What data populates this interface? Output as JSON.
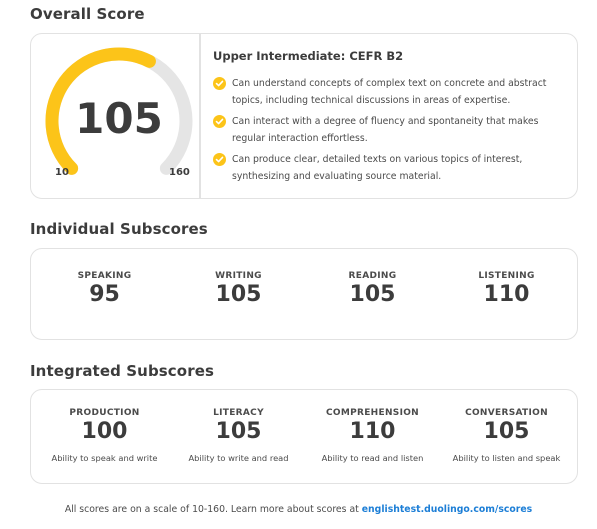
{
  "overall": {
    "title": "Overall Score",
    "score": "105",
    "min_label": "10",
    "max_label": "160",
    "progress_fraction": 0.6,
    "gauge_color": "#fcc419",
    "gauge_track_color": "#e5e5e5",
    "level_title": "Upper Intermediate: CEFR B2",
    "descriptors": [
      "Can understand concepts of complex text on concrete and abstract topics, including technical discussions in areas of expertise.",
      "Can interact with a degree of fluency and spontaneity that makes regular interaction effortless.",
      "Can produce clear, detailed texts on various topics of interest, synthesizing and evaluating source material."
    ],
    "descriptor_icon": "check-circle-icon"
  },
  "individual": {
    "title": "Individual Subscores",
    "items": [
      {
        "label": "SPEAKING",
        "value": "95"
      },
      {
        "label": "WRITING",
        "value": "105"
      },
      {
        "label": "READING",
        "value": "105"
      },
      {
        "label": "LISTENING",
        "value": "110"
      }
    ]
  },
  "integrated": {
    "title": "Integrated Subscores",
    "items": [
      {
        "label": "PRODUCTION",
        "value": "100",
        "desc": "Ability to speak and write"
      },
      {
        "label": "LITERACY",
        "value": "105",
        "desc": "Ability to write and read"
      },
      {
        "label": "COMPREHENSION",
        "value": "110",
        "desc": "Ability to read and listen"
      },
      {
        "label": "CONVERSATION",
        "value": "105",
        "desc": "Ability to listen and speak"
      }
    ]
  },
  "footer": {
    "text": "All scores are on a scale of 10-160. Learn more about scores at ",
    "link_text": "englishtest.duolingo.com/scores",
    "link_color": "#1c7ed6"
  }
}
